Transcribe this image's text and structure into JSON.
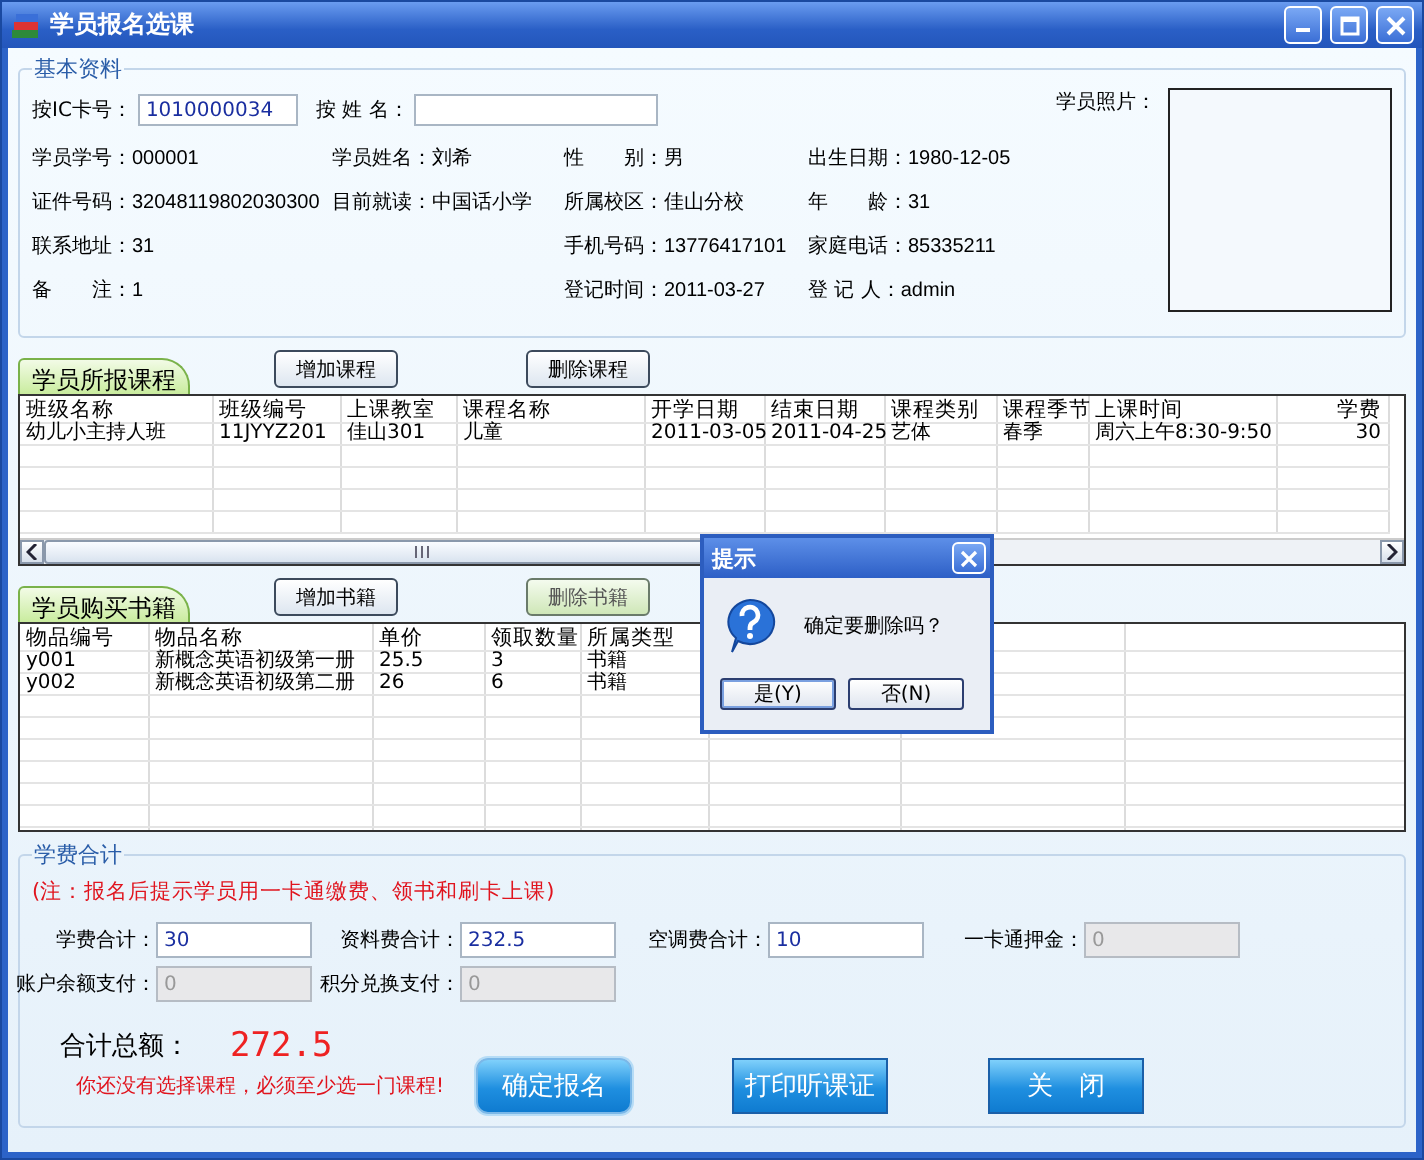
{
  "window": {
    "title": "学员报名选课"
  },
  "basic_info": {
    "title": "基本资料",
    "search": [
      {
        "label": "按IC卡号：",
        "value": "1010000034"
      },
      {
        "label": "按 姓 名："
      }
    ],
    "photo_label": "学员照片：",
    "rows": [
      [
        {
          "label": "学员学号：",
          "value": "000001"
        },
        {
          "label": "学员姓名：",
          "value": "刘希"
        },
        {
          "label": "性　　别：",
          "value": "男"
        },
        {
          "label": "出生日期：",
          "value": "1980-12-05"
        }
      ],
      [
        {
          "label": "证件号码：",
          "value": "32048119802030300"
        },
        {
          "label": "目前就读：",
          "value": "中国话小学"
        },
        {
          "label": "所属校区：",
          "value": "佳山分校"
        },
        {
          "label": "年　　龄：",
          "value": "31"
        }
      ],
      [
        {
          "label": "联系地址：",
          "value": "31"
        },
        null,
        {
          "label": "手机号码：",
          "value": "13776417101"
        },
        {
          "label": "家庭电话：",
          "value": "85335211"
        }
      ],
      [
        {
          "label": "备　　注：",
          "value": "1"
        },
        null,
        {
          "label": "登记时间：",
          "value": "2011-03-27"
        },
        {
          "label": "登 记 人：",
          "value": "admin"
        }
      ]
    ]
  },
  "courses": {
    "tab": "学员所报课程",
    "buttons": [
      {
        "label": "增加课程",
        "highlighted": false
      },
      {
        "label": "删除课程",
        "highlighted": false
      }
    ],
    "columns": [
      "班级名称",
      "班级编号",
      "上课教室",
      "课程名称",
      "开学日期",
      "结束日期",
      "课程类别",
      "课程季节",
      "上课时间",
      "学费"
    ],
    "rows": [
      [
        "幼儿小主持人班",
        "11JYYZ201",
        "佳山301",
        "儿童",
        "2011-03-05",
        "2011-04-25",
        "艺体",
        "春季",
        "周六上午8:30-9:50",
        "30"
      ]
    ]
  },
  "books": {
    "tab": "学员购买书籍",
    "buttons": [
      {
        "label": "增加书籍",
        "highlighted": false
      },
      {
        "label": "删除书籍",
        "highlighted": true
      }
    ],
    "columns": [
      "物品编号",
      "物品名称",
      "单价",
      "领取数量",
      "所属类型"
    ],
    "rows": [
      [
        "y001",
        "新概念英语初级第一册",
        "25.5",
        "3",
        "书籍"
      ],
      [
        "y002",
        "新概念英语初级第二册",
        "26",
        "6",
        "书籍"
      ]
    ]
  },
  "fees": {
    "title": "学费合计",
    "note": "(注：报名后提示学员用一卡通缴费、领书和刷卡上课)",
    "rows": [
      [
        {
          "label": "学费合计：",
          "value": "30",
          "disabled": false
        },
        {
          "label": "资料费合计：",
          "value": "232.5",
          "disabled": false
        },
        {
          "label": "空调费合计：",
          "value": "10",
          "disabled": false
        },
        {
          "label": "一卡通押金：",
          "value": "0",
          "disabled": true
        }
      ],
      [
        {
          "label": "账户余额支付：",
          "value": "0",
          "disabled": true
        },
        {
          "label": "积分兑换支付：",
          "value": "0",
          "disabled": true
        }
      ]
    ],
    "total_label": "合计总额：",
    "total": "272.5"
  },
  "warning": "你还没有选择课程，必须至少选一门课程!",
  "actions": [
    {
      "label": "确定报名",
      "focused": true
    },
    {
      "label": "打印听课证",
      "focused": false
    },
    {
      "label": "关　闭",
      "focused": false
    }
  ],
  "dialog": {
    "title": "提示",
    "message": "确定要删除吗？",
    "buttons": [
      {
        "label": "是(Y)",
        "default": true
      },
      {
        "label": "否(N)",
        "default": false
      }
    ]
  }
}
